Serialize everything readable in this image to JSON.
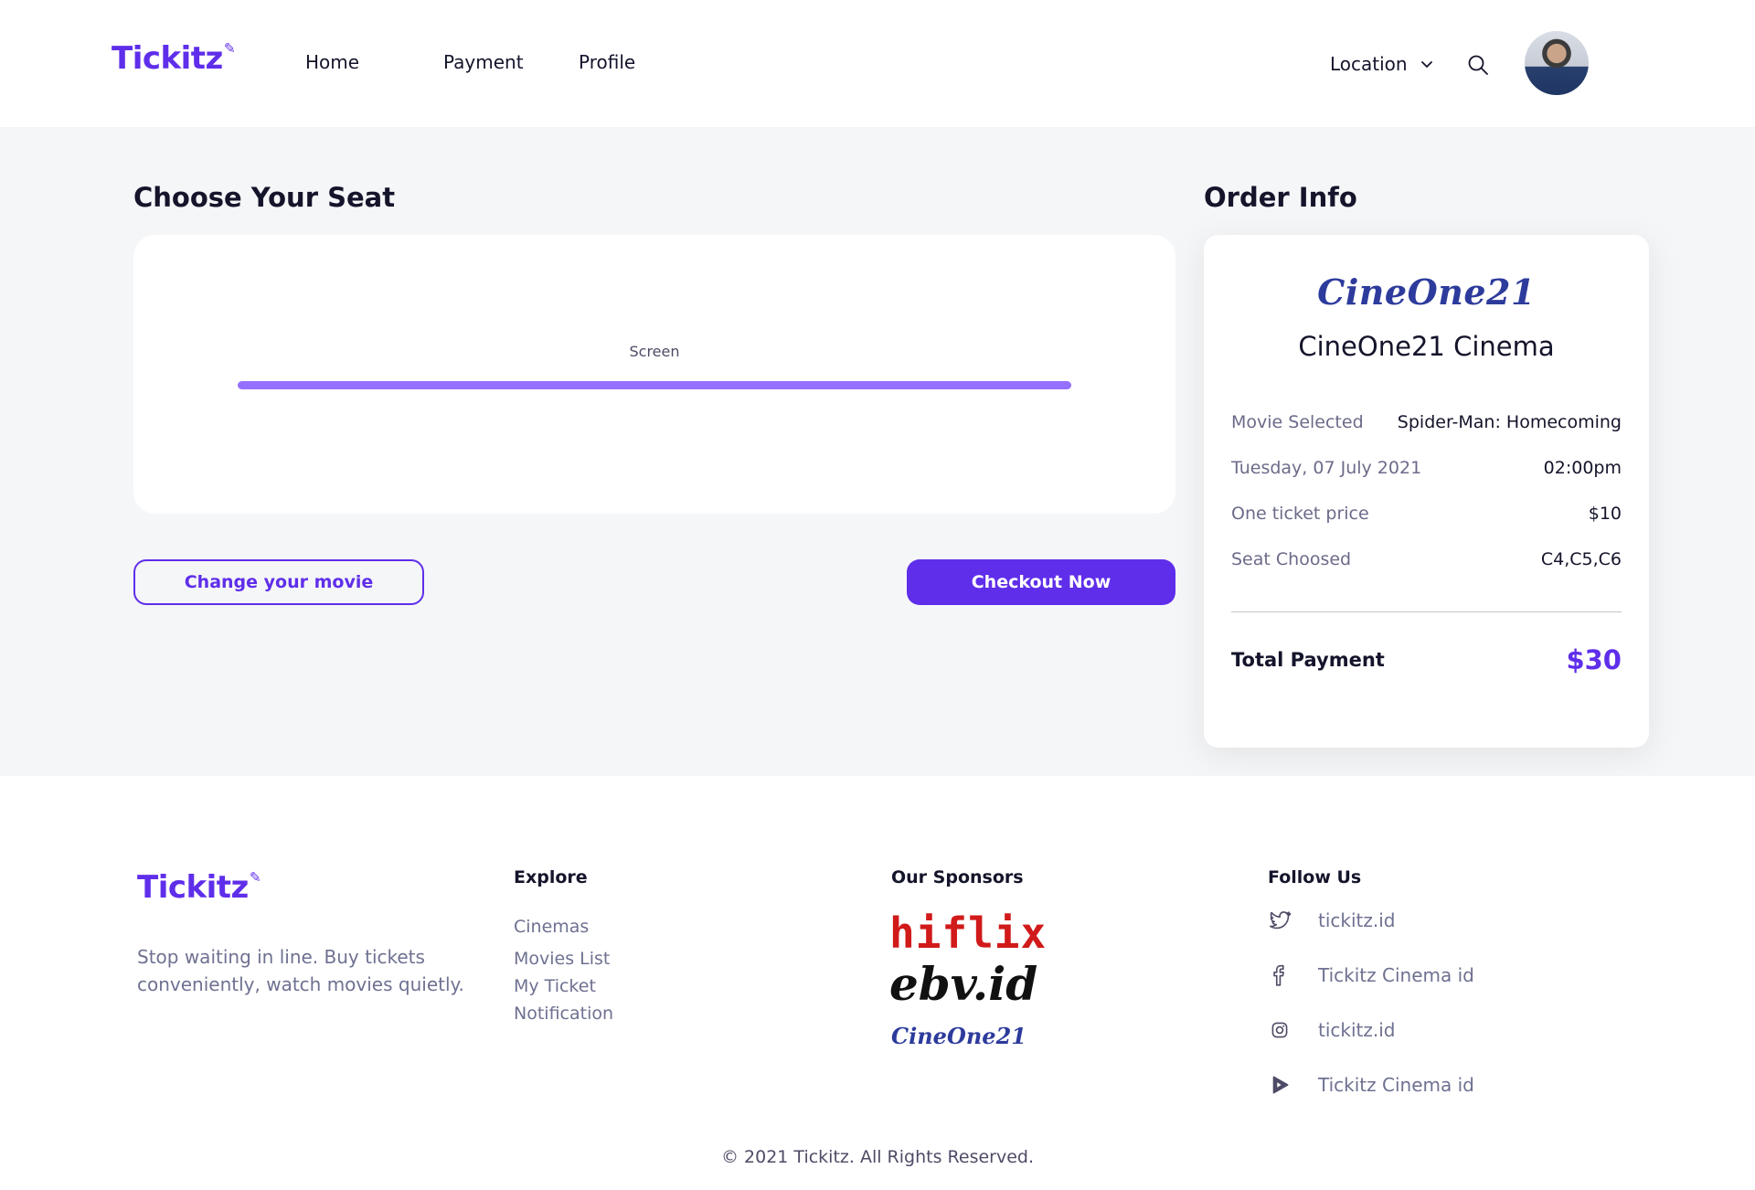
{
  "brand": {
    "name": "Tickitz",
    "color": "#5f2eea"
  },
  "nav": {
    "items": [
      {
        "label": "Home"
      },
      {
        "label": "Payment"
      },
      {
        "label": "Profile"
      }
    ],
    "location_label": "Location",
    "icons": [
      "chevron-down-icon",
      "search-icon"
    ]
  },
  "seat_section": {
    "title": "Choose Your Seat",
    "screen_label": "Screen",
    "screen_bar_color": "#9570fe",
    "change_button": "Change your movie",
    "checkout_button": "Checkout Now"
  },
  "order_info": {
    "title": "Order Info",
    "cinema_logo_text": "CineOne21",
    "cinema_name": "CineOne21 Cinema",
    "rows": [
      {
        "key": "Movie Selected",
        "value": "Spider-Man: Homecoming"
      },
      {
        "key": "Tuesday, 07 July 2021",
        "value": "02:00pm"
      },
      {
        "key": "One ticket price",
        "value": "$10"
      },
      {
        "key": "Seat Choosed",
        "value": "C4,C5,C6"
      }
    ],
    "total_label": "Total Payment",
    "total_value": "$30"
  },
  "footer": {
    "tagline": "Stop waiting in line. Buy tickets conveniently, watch movies quietly.",
    "explore": {
      "title": "Explore",
      "items": [
        "Cinemas",
        "Movies List",
        "My Ticket",
        "Notification"
      ]
    },
    "sponsors": {
      "title": "Our Sponsors",
      "items": [
        "hiflix",
        "ebv.id",
        "CineOne21"
      ]
    },
    "follow": {
      "title": "Follow Us",
      "items": [
        {
          "icon": "twitter-icon",
          "label": "tickitz.id"
        },
        {
          "icon": "facebook-icon",
          "label": "Tickitz Cinema id"
        },
        {
          "icon": "instagram-icon",
          "label": "tickitz.id"
        },
        {
          "icon": "youtube-icon",
          "label": "Tickitz Cinema id"
        }
      ]
    },
    "copyright": "© 2021 Tickitz. All Rights Reserved."
  }
}
